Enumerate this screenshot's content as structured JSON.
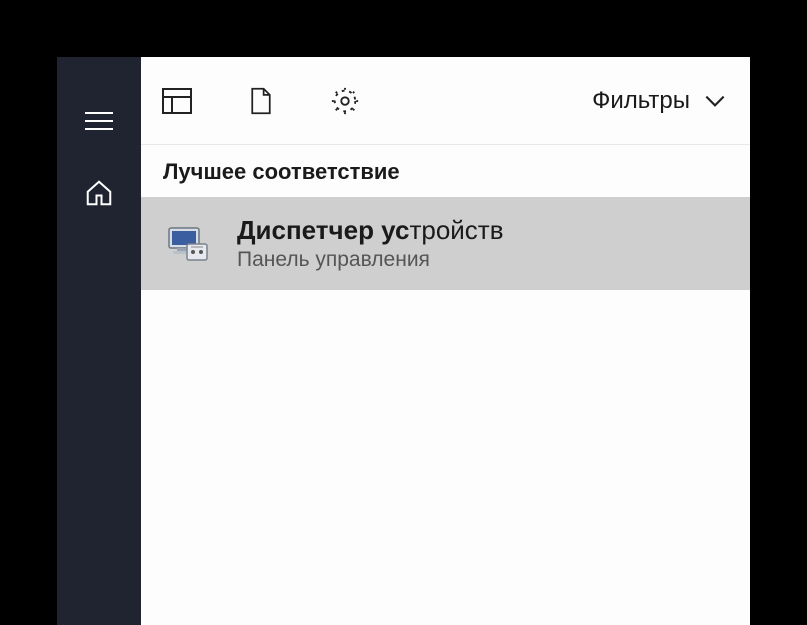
{
  "topbar": {
    "filters_label": "Фильтры"
  },
  "section": {
    "best_match": "Лучшее соответствие"
  },
  "result": {
    "title_match": "Диспетчер ус",
    "title_rest": "тройств",
    "subtitle": "Панель управления"
  }
}
